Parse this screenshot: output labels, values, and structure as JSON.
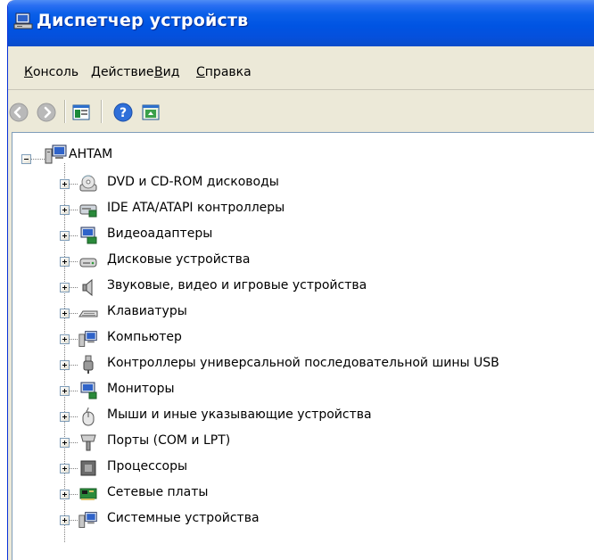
{
  "window": {
    "title": "Диспетчер устройств"
  },
  "menu": [
    {
      "label": "Консоль",
      "accel": "К",
      "rest": "онсоль"
    },
    {
      "label": "Действие",
      "accel": "Д",
      "rest": "ействие"
    },
    {
      "label": "Вид",
      "accel": "В",
      "rest": "ид"
    },
    {
      "label": "Справка",
      "accel": "С",
      "rest": "правка"
    }
  ],
  "toolbar": {
    "buttons": [
      "back-icon",
      "forward-icon",
      "properties-icon",
      "help-icon",
      "update-driver-icon"
    ]
  },
  "tree": {
    "root": {
      "label": "AHTAM",
      "icon": "computer-icon"
    },
    "items": [
      {
        "label": "DVD и CD-ROM дисководы",
        "icon": "cdrom-drive-icon"
      },
      {
        "label": "IDE ATA/ATAPI контроллеры",
        "icon": "ide-controller-icon"
      },
      {
        "label": "Видеоадаптеры",
        "icon": "display-adapter-icon"
      },
      {
        "label": "Дисковые устройства",
        "icon": "disk-drive-icon"
      },
      {
        "label": "Звуковые, видео и игровые устройства",
        "icon": "speaker-icon"
      },
      {
        "label": "Клавиатуры",
        "icon": "keyboard-icon"
      },
      {
        "label": "Компьютер",
        "icon": "computer-icon"
      },
      {
        "label": "Контроллеры универсальной последовательной шины USB",
        "icon": "usb-plug-icon"
      },
      {
        "label": "Мониторы",
        "icon": "monitor-icon"
      },
      {
        "label": "Мыши и иные указывающие устройства",
        "icon": "mouse-icon"
      },
      {
        "label": "Порты (COM и LPT)",
        "icon": "port-icon"
      },
      {
        "label": "Процессоры",
        "icon": "processor-icon"
      },
      {
        "label": "Сетевые платы",
        "icon": "network-card-icon"
      },
      {
        "label": "Системные устройства",
        "icon": "system-devices-icon"
      }
    ]
  }
}
